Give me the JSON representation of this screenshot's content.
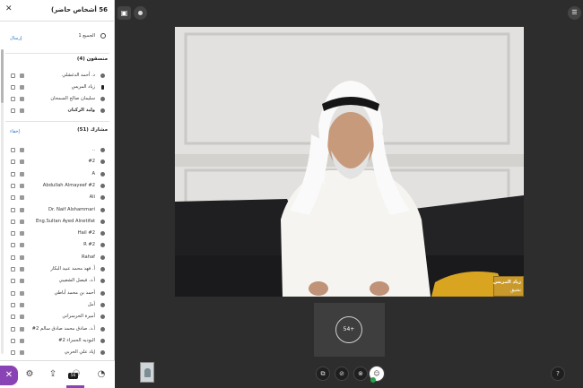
{
  "sidebar": {
    "title": "56 أشخاص حاضر)",
    "close_icon": "close-icon",
    "everyone": {
      "label": "الجميع 1",
      "link": "إرسال"
    },
    "moderators": {
      "header": "منسقون (4)",
      "items": [
        {
          "name": "د. أحمد الدغشلي",
          "bold": false
        },
        {
          "name": "زياد المريس",
          "bold": false
        },
        {
          "name": "سليمان صالح السمحان",
          "bold": false
        },
        {
          "name": "وليد الركبان",
          "bold": true
        }
      ]
    },
    "participants": {
      "header": "مشارك (51)",
      "link": "إخفاء",
      "items": [
        "..",
        "#2",
        "A",
        "Abdullah Almayeef #2",
        "Ali",
        "Dr. Naif Alshammari",
        "Eng.Sultan Ayed Alnetifat",
        "Hail #2",
        "R #2",
        "Rahaf",
        "أ. فهد محمد عبيد البكار",
        "أ.د. فيصل الشعيبي",
        "أحمد بن محمد أباطي",
        "أمل",
        "أميرة الحرسراني",
        "أ.د. صادق محمد صادق سالم 2#",
        "البوديه الحمزاء 2#",
        "إياد علي الحربي"
      ]
    },
    "footer": {
      "count": "56"
    }
  },
  "stage": {
    "speaker": {
      "name": "زياد المريس",
      "status": "نشيق"
    },
    "tile_label": "54+",
    "controls": [
      "share-icon",
      "camera-off-icon",
      "mic-off-icon",
      "user-icon",
      "help-icon"
    ]
  }
}
